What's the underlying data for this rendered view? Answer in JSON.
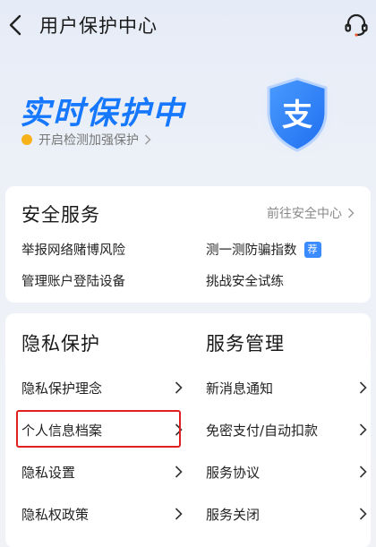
{
  "nav": {
    "title": "用户保护中心",
    "back_icon": "chevron-left-icon",
    "service_icon": "headset-icon"
  },
  "hero": {
    "headline": "实时保护中",
    "subtitle": "开启检测加强保护",
    "shield_glyph": "支",
    "colors": {
      "accent": "#1677ff",
      "dot": "#f7b21a"
    }
  },
  "security": {
    "title": "安全服务",
    "link": "前往安全中心",
    "items": [
      {
        "label": "举报网络赌博风险"
      },
      {
        "label": "测一测防骗指数",
        "badge": "荐"
      },
      {
        "label": "管理账户登陆设备"
      },
      {
        "label": "挑战安全试练"
      }
    ]
  },
  "privacy": {
    "title": "隐私保护",
    "items": [
      {
        "label": "隐私保护理念"
      },
      {
        "label": "个人信息档案"
      },
      {
        "label": "隐私设置"
      },
      {
        "label": "隐私权政策"
      }
    ]
  },
  "service_mgmt": {
    "title": "服务管理",
    "items": [
      {
        "label": "新消息通知"
      },
      {
        "label": "免密支付/自动扣款"
      },
      {
        "label": "服务协议"
      },
      {
        "label": "服务关闭"
      }
    ]
  }
}
